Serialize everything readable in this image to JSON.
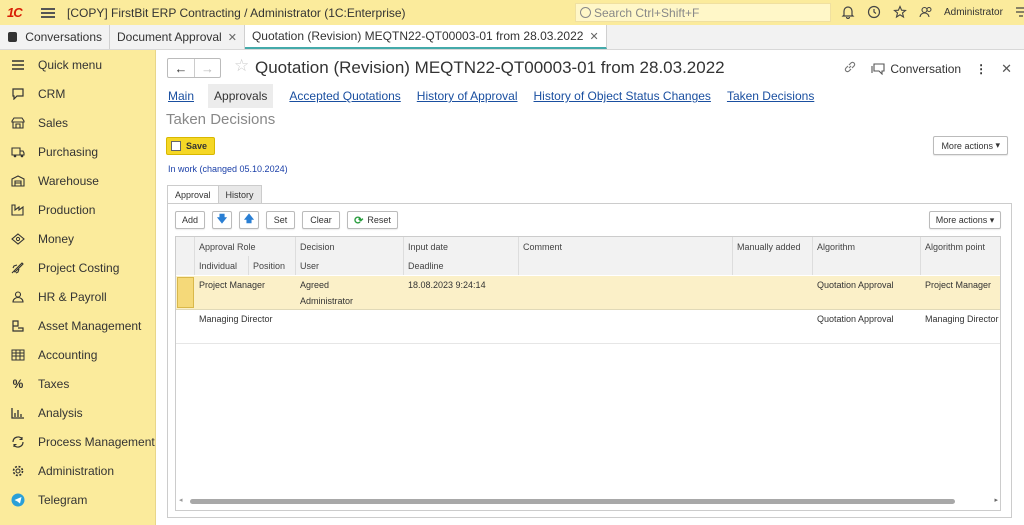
{
  "app": {
    "logo": "1С",
    "title": "[COPY] FirstBit ERP Contracting / Administrator  (1C:Enterprise)",
    "search_placeholder": "Search Ctrl+Shift+F",
    "user": "Administrator"
  },
  "tabs": [
    {
      "label": "Conversations"
    },
    {
      "label": "Document Approval"
    },
    {
      "label": "Quotation (Revision) MEQTN22-QT00003-01 from 28.03.2022"
    }
  ],
  "sidebar": {
    "items": [
      {
        "label": "Quick menu",
        "icon": "menu-icon"
      },
      {
        "label": "CRM",
        "icon": "chat-icon"
      },
      {
        "label": "Sales",
        "icon": "shop-icon"
      },
      {
        "label": "Purchasing",
        "icon": "truck-icon"
      },
      {
        "label": "Warehouse",
        "icon": "warehouse-icon"
      },
      {
        "label": "Production",
        "icon": "factory-icon"
      },
      {
        "label": "Money",
        "icon": "money-icon"
      },
      {
        "label": "Project Costing",
        "icon": "rocket-icon"
      },
      {
        "label": "HR & Payroll",
        "icon": "person-icon"
      },
      {
        "label": "Asset Management",
        "icon": "asset-icon"
      },
      {
        "label": "Accounting",
        "icon": "ledger-icon"
      },
      {
        "label": "Taxes",
        "icon": "percent-icon"
      },
      {
        "label": "Analysis",
        "icon": "bar-chart-icon"
      },
      {
        "label": "Process Management",
        "icon": "cycle-icon"
      },
      {
        "label": "Administration",
        "icon": "gear-icon"
      },
      {
        "label": "Telegram",
        "icon": "telegram-icon"
      }
    ]
  },
  "document": {
    "title": "Quotation (Revision) MEQTN22-QT00003-01 from 28.03.2022",
    "conversation_label": "Conversation",
    "links": [
      "Main",
      "Approvals",
      "Accepted Quotations",
      "History of Approval",
      "History of Object Status Changes",
      "Taken Decisions"
    ],
    "section_title": "Taken Decisions",
    "save_label": "Save",
    "more_actions": "More actions",
    "status": "In work (changed 05.10.2024)",
    "subtabs": [
      "Approval",
      "History"
    ]
  },
  "toolbar": {
    "add": "Add",
    "set": "Set",
    "clear": "Clear",
    "reset": "Reset",
    "more_actions": "More actions"
  },
  "table": {
    "headers_row1": [
      "Approval Role",
      "Decision",
      "Input date",
      "Comment",
      "Manually added",
      "Algorithm",
      "Algorithm point"
    ],
    "headers_row2": [
      "Individual",
      "Position",
      "User",
      "Deadline"
    ],
    "rows": [
      {
        "role": "Project Manager",
        "decision": "Agreed",
        "input_date": "18.08.2023 9:24:14",
        "user": "Administrator",
        "algorithm": "Quotation Approval",
        "algorithm_point": "Project Manager"
      },
      {
        "role": "Managing Director",
        "decision": "",
        "input_date": "",
        "user": "",
        "algorithm": "Quotation Approval",
        "algorithm_point": "Managing Director"
      }
    ]
  }
}
